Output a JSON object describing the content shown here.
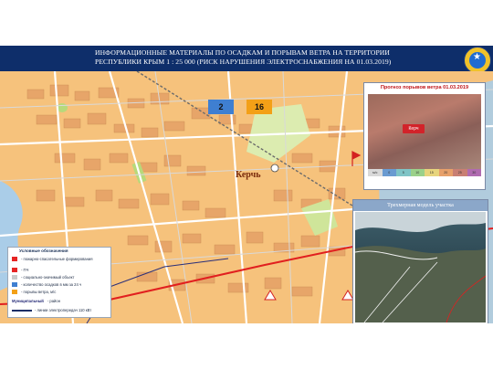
{
  "header": {
    "title_line1": "ИНФОРМАЦИОННЫЕ МАТЕРИАЛЫ ПО ОСАДКАМ И ПОРЫВАМ ВЕТРА НА ТЕРРИТОРИИ",
    "title_line2": "РЕСПУБЛИКИ КРЫМ 1 : 25 000 (РИСК НАРУШЕНИЯ ЭЛЕКТРОСНАБЖЕНИЯ НА 01.03.2019)"
  },
  "map": {
    "city_label": "Керчь",
    "count_a": "2",
    "count_b": "16",
    "colors": {
      "land": "#f6c27c",
      "water": "#aacde8",
      "powerline": "#e11f1f",
      "district": "#2a2f7a"
    }
  },
  "forecast": {
    "title": "Прогноз порывов ветра 01.03.2019",
    "city_pill": "Керч",
    "scale": [
      "м/с",
      "0",
      "5",
      "10",
      "15",
      "20",
      "25",
      "30"
    ]
  },
  "model": {
    "title": "Трехмерная модель участка"
  },
  "legend": {
    "title": "Условные обозначения",
    "items": [
      {
        "label": "- пожарно-спасательные формирования",
        "color": "#e62424"
      },
      {
        "label": "- ПЧ",
        "color": "#e62424"
      },
      {
        "label": "- социально-значимый объект",
        "color": "#c9c9c9"
      },
      {
        "label": "- количество осадков в мм за 24 ч",
        "color": "#3f7fd1"
      },
      {
        "label": "- порывы ветра, м/с",
        "color": "#f3a017"
      },
      {
        "label": "- район",
        "color": "#2a2f7a"
      },
      {
        "label": "- линии электропередач 110 кВт",
        "color": "#1c2e66"
      }
    ],
    "district_tag": "Муниципальный"
  }
}
